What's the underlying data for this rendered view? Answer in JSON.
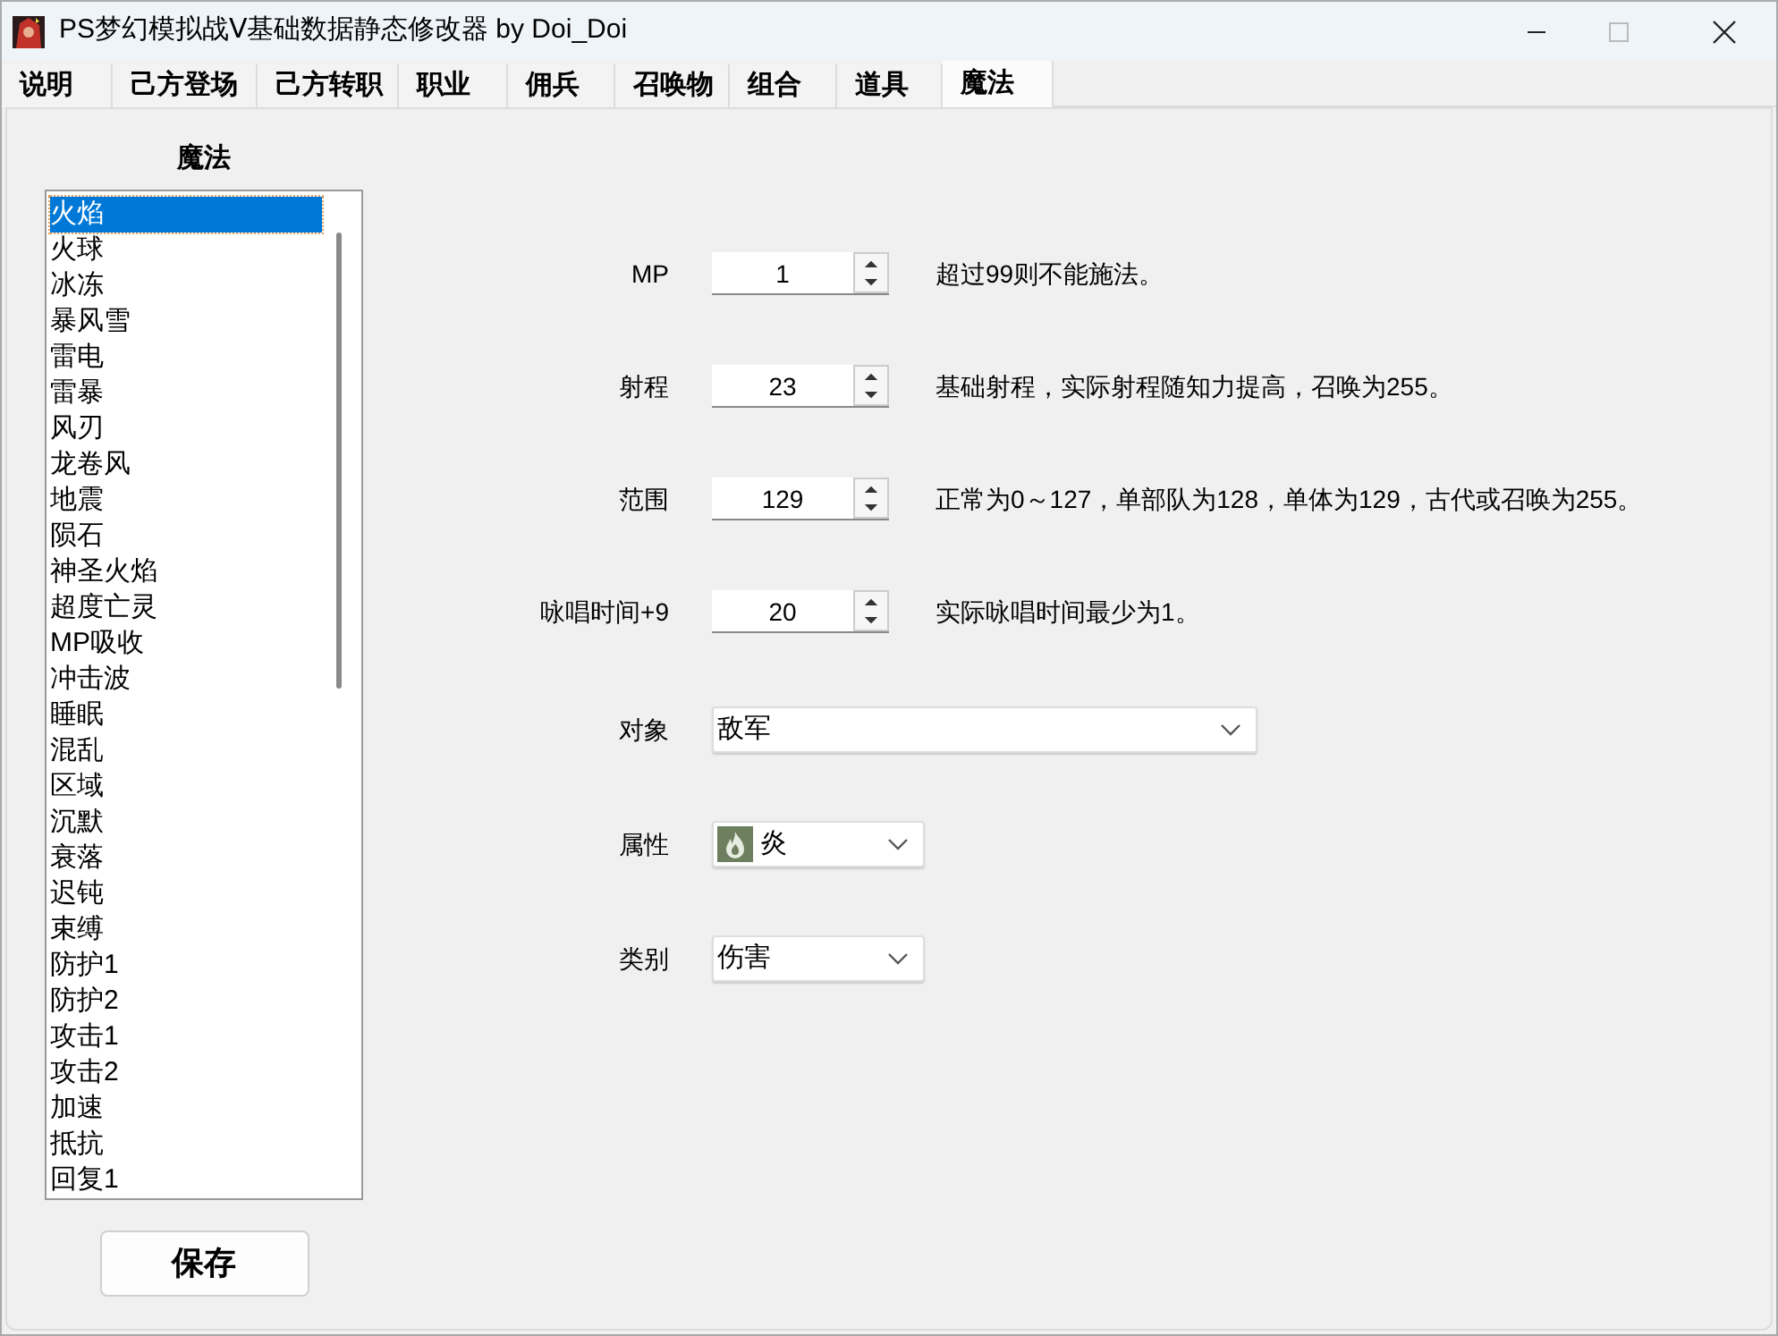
{
  "window": {
    "title": "PS梦幻模拟战Ⅴ基础数据静态修改器 by Doi_Doi"
  },
  "tabs": [
    {
      "label": "说明",
      "selected": false
    },
    {
      "label": "己方登场",
      "selected": false
    },
    {
      "label": "己方转职",
      "selected": false
    },
    {
      "label": "职业",
      "selected": false
    },
    {
      "label": "佣兵",
      "selected": false
    },
    {
      "label": "召唤物",
      "selected": false
    },
    {
      "label": "组合",
      "selected": false
    },
    {
      "label": "道具",
      "selected": false
    },
    {
      "label": "魔法",
      "selected": true
    }
  ],
  "list": {
    "heading": "魔法",
    "items": [
      {
        "label": "火焰",
        "selected": true
      },
      {
        "label": "火球",
        "selected": false
      },
      {
        "label": "冰冻",
        "selected": false
      },
      {
        "label": "暴风雪",
        "selected": false
      },
      {
        "label": "雷电",
        "selected": false
      },
      {
        "label": "雷暴",
        "selected": false
      },
      {
        "label": "风刃",
        "selected": false
      },
      {
        "label": "龙卷风",
        "selected": false
      },
      {
        "label": "地震",
        "selected": false
      },
      {
        "label": "陨石",
        "selected": false
      },
      {
        "label": "神圣火焰",
        "selected": false
      },
      {
        "label": "超度亡灵",
        "selected": false
      },
      {
        "label": "MP吸收",
        "selected": false
      },
      {
        "label": "冲击波",
        "selected": false
      },
      {
        "label": "睡眠",
        "selected": false
      },
      {
        "label": "混乱",
        "selected": false
      },
      {
        "label": "区域",
        "selected": false
      },
      {
        "label": "沉默",
        "selected": false
      },
      {
        "label": "衰落",
        "selected": false
      },
      {
        "label": "迟钝",
        "selected": false
      },
      {
        "label": "束缚",
        "selected": false
      },
      {
        "label": "防护1",
        "selected": false
      },
      {
        "label": "防护2",
        "selected": false
      },
      {
        "label": "攻击1",
        "selected": false
      },
      {
        "label": "攻击2",
        "selected": false
      },
      {
        "label": "加速",
        "selected": false
      },
      {
        "label": "抵抗",
        "selected": false
      },
      {
        "label": "回复1",
        "selected": false
      }
    ]
  },
  "save_button": "保存",
  "fields": [
    {
      "kind": "spinner",
      "label": "MP",
      "value": "1",
      "hint": "超过99则不能施法。"
    },
    {
      "kind": "spinner",
      "label": "射程",
      "value": "23",
      "hint": "基础射程，实际射程随知力提高，召唤为255。"
    },
    {
      "kind": "spinner",
      "label": "范围",
      "value": "129",
      "hint": "正常为0～127，单部队为128，单体为129，古代或召唤为255。"
    },
    {
      "kind": "spinner",
      "label": "咏唱时间+9",
      "value": "20",
      "hint": "实际咏唱时间最少为1。"
    },
    {
      "kind": "wide_dropdown",
      "label": "对象",
      "value": "敌军"
    },
    {
      "kind": "icon_dropdown",
      "label": "属性",
      "value": "炎"
    },
    {
      "kind": "dropdown",
      "label": "类别",
      "value": "伤害"
    }
  ]
}
